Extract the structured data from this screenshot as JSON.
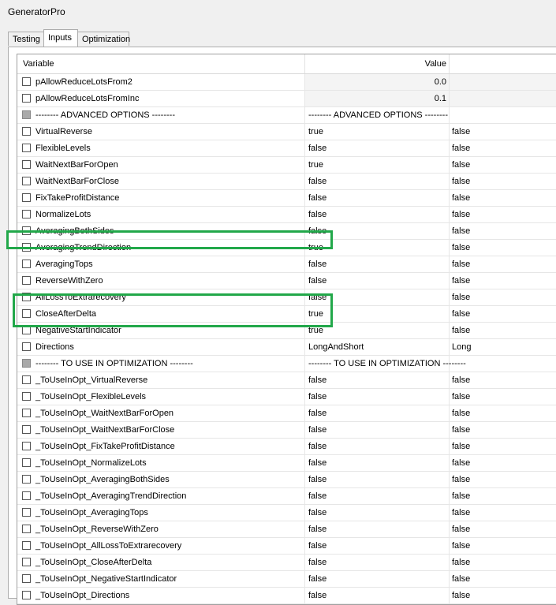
{
  "window": {
    "title": "GeneratorPro"
  },
  "tabs": [
    {
      "label": "Testing"
    },
    {
      "label": "Inputs"
    },
    {
      "label": "Optimization"
    }
  ],
  "grid": {
    "columns": {
      "variable": "Variable",
      "value": "Value"
    },
    "rows": [
      {
        "name": "pAllowReduceLotsFrom2",
        "value": "0.0",
        "value2": ""
      },
      {
        "name": "pAllowReduceLotsFromInc",
        "value": "0.1",
        "value2": ""
      },
      {
        "name": "-------- ADVANCED OPTIONS --------",
        "value": "-------- ADVANCED OPTIONS --------",
        "value2": ""
      },
      {
        "name": "VirtualReverse",
        "value": "true",
        "value2": "false"
      },
      {
        "name": "FlexibleLevels",
        "value": "false",
        "value2": "false"
      },
      {
        "name": "WaitNextBarForOpen",
        "value": "true",
        "value2": "false"
      },
      {
        "name": "WaitNextBarForClose",
        "value": "false",
        "value2": "false"
      },
      {
        "name": "FixTakeProfitDistance",
        "value": "false",
        "value2": "false"
      },
      {
        "name": "NormalizeLots",
        "value": "false",
        "value2": "false"
      },
      {
        "name": "AveragingBothSides",
        "value": "false",
        "value2": "false"
      },
      {
        "name": "AveragingTrendDirection",
        "value": "true",
        "value2": "false"
      },
      {
        "name": "AveragingTops",
        "value": "false",
        "value2": "false"
      },
      {
        "name": "ReverseWithZero",
        "value": "false",
        "value2": "false"
      },
      {
        "name": "AllLossToExtrarecovery",
        "value": "false",
        "value2": "false"
      },
      {
        "name": "CloseAfterDelta",
        "value": "true",
        "value2": "false"
      },
      {
        "name": "NegativeStartIndicator",
        "value": "true",
        "value2": "false"
      },
      {
        "name": "Directions",
        "value": "LongAndShort",
        "value2": "Long"
      },
      {
        "name": "-------- TO USE IN OPTIMIZATION --------",
        "value": "-------- TO USE IN OPTIMIZATION --------",
        "value2": ""
      },
      {
        "name": "_ToUseInOpt_VirtualReverse",
        "value": "false",
        "value2": "false"
      },
      {
        "name": "_ToUseInOpt_FlexibleLevels",
        "value": "false",
        "value2": "false"
      },
      {
        "name": "_ToUseInOpt_WaitNextBarForOpen",
        "value": "false",
        "value2": "false"
      },
      {
        "name": "_ToUseInOpt_WaitNextBarForClose",
        "value": "false",
        "value2": "false"
      },
      {
        "name": "_ToUseInOpt_FixTakeProfitDistance",
        "value": "false",
        "value2": "false"
      },
      {
        "name": "_ToUseInOpt_NormalizeLots",
        "value": "false",
        "value2": "false"
      },
      {
        "name": "_ToUseInOpt_AveragingBothSides",
        "value": "false",
        "value2": "false"
      },
      {
        "name": "_ToUseInOpt_AveragingTrendDirection",
        "value": "false",
        "value2": "false"
      },
      {
        "name": "_ToUseInOpt_AveragingTops",
        "value": "false",
        "value2": "false"
      },
      {
        "name": "_ToUseInOpt_ReverseWithZero",
        "value": "false",
        "value2": "false"
      },
      {
        "name": "_ToUseInOpt_AllLossToExtrarecovery",
        "value": "false",
        "value2": "false"
      },
      {
        "name": "_ToUseInOpt_CloseAfterDelta",
        "value": "false",
        "value2": "false"
      },
      {
        "name": "_ToUseInOpt_NegativeStartIndicator",
        "value": "false",
        "value2": "false"
      },
      {
        "name": "_ToUseInOpt_Directions",
        "value": "false",
        "value2": "false"
      }
    ]
  },
  "colors": {
    "highlight": "#22a84a"
  }
}
